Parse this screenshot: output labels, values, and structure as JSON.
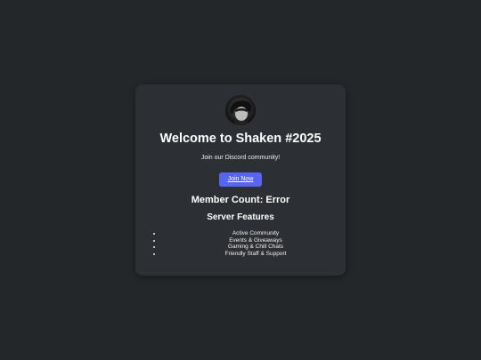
{
  "card": {
    "title": "Welcome to Shaken #2025",
    "subtitle": "Join our Discord community!",
    "join_button": "Join Now",
    "member_count": "Member Count: Error",
    "features_title": "Server Features",
    "features": [
      "Active Community",
      "Events & Giveaways",
      "Gaming & Chill Chats",
      "Friendly Staff & Support"
    ]
  },
  "colors": {
    "background": "#23272a",
    "card": "#2c2f33",
    "accent": "#5865f2"
  }
}
